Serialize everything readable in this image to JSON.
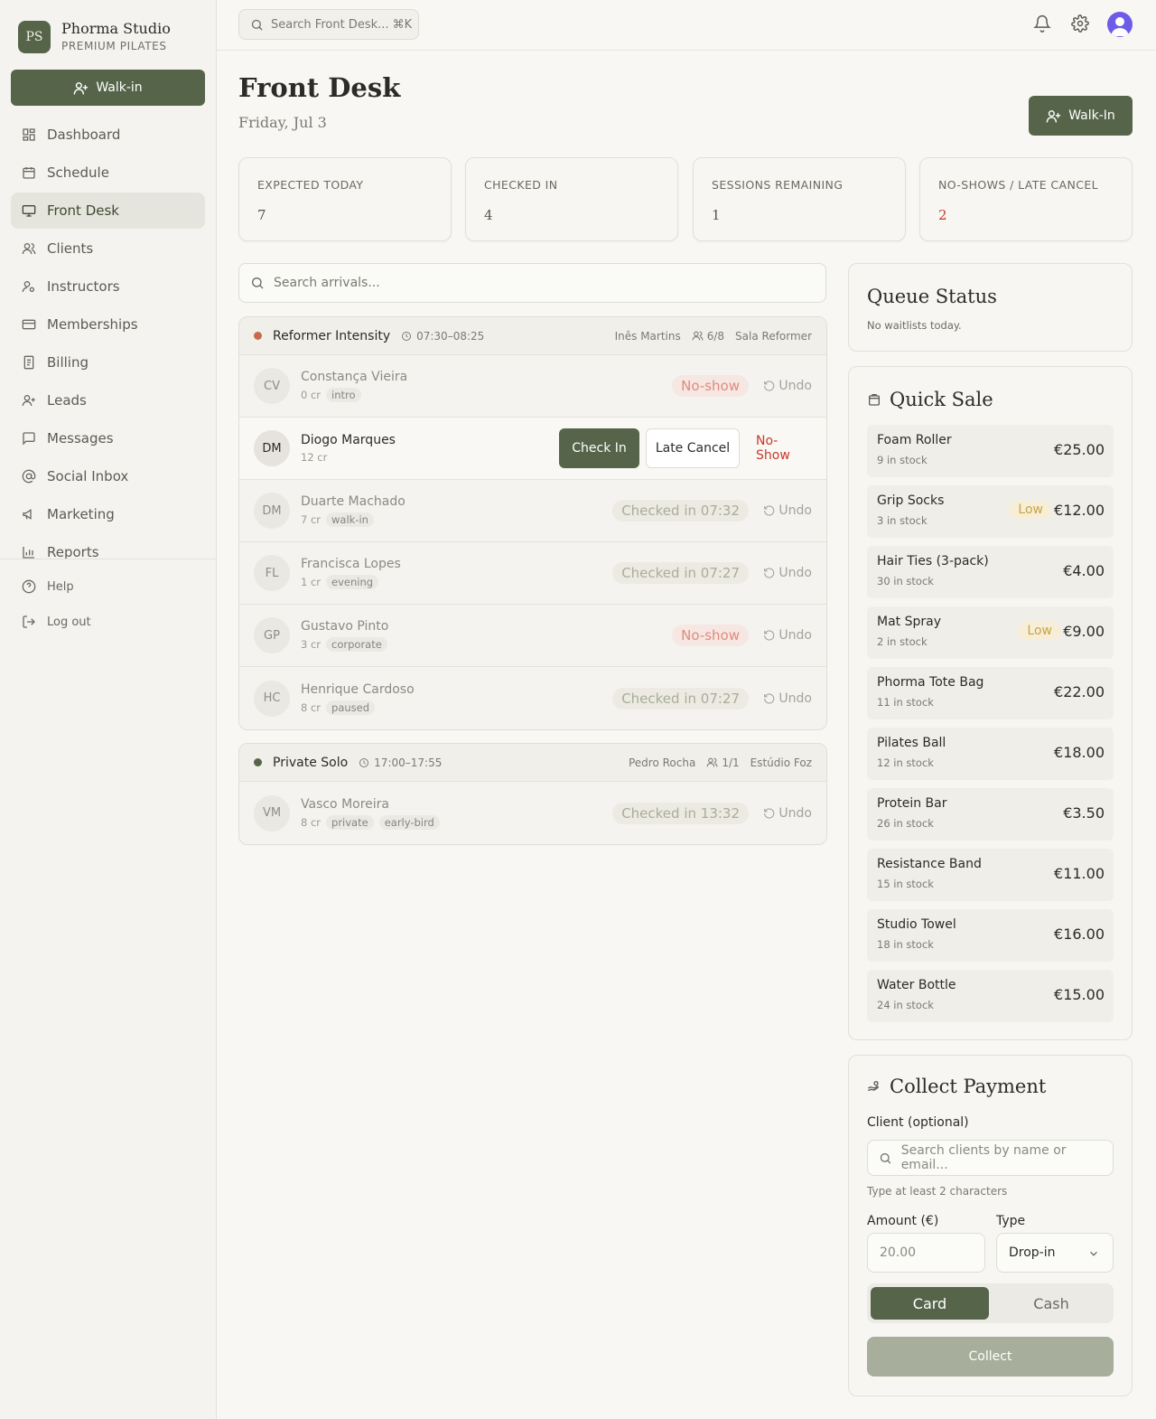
{
  "brand": {
    "initials": "PS",
    "name": "Phorma Studio",
    "tagline": "PREMIUM PILATES"
  },
  "sidebar": {
    "walkin_label": "Walk-in",
    "items": [
      {
        "label": "Dashboard",
        "icon": "dashboard-icon"
      },
      {
        "label": "Schedule",
        "icon": "calendar-icon"
      },
      {
        "label": "Front Desk",
        "icon": "monitor-icon",
        "active": true
      },
      {
        "label": "Clients",
        "icon": "users-icon"
      },
      {
        "label": "Instructors",
        "icon": "instructor-icon"
      },
      {
        "label": "Memberships",
        "icon": "card-icon"
      },
      {
        "label": "Billing",
        "icon": "receipt-icon"
      },
      {
        "label": "Leads",
        "icon": "user-plus-icon"
      },
      {
        "label": "Messages",
        "icon": "message-icon"
      },
      {
        "label": "Social Inbox",
        "icon": "at-icon"
      },
      {
        "label": "Marketing",
        "icon": "megaphone-icon"
      },
      {
        "label": "Reports",
        "icon": "bar-chart-icon"
      }
    ],
    "footer": [
      {
        "label": "Help",
        "icon": "help-icon"
      },
      {
        "label": "Log out",
        "icon": "logout-icon"
      }
    ]
  },
  "topbar": {
    "search_placeholder": "Search Front Desk... ⌘K"
  },
  "header": {
    "title": "Front Desk",
    "date": "Friday, Jul 3",
    "walkin_label": "Walk-In"
  },
  "stats": [
    {
      "label": "EXPECTED TODAY",
      "value": "7"
    },
    {
      "label": "CHECKED IN",
      "value": "4"
    },
    {
      "label": "SESSIONS REMAINING",
      "value": "1"
    },
    {
      "label": "NO-SHOWS / LATE CANCEL",
      "value": "2"
    }
  ],
  "arrivals": {
    "search_placeholder": "Search arrivals...",
    "sessions": [
      {
        "title": "Reformer Intensity",
        "time": "07:30–08:25",
        "instructor": "Inês Martins",
        "capacity": "6/8",
        "room": "Sala Reformer",
        "clients": [
          {
            "initials": "CV",
            "name": "Constança Vieira",
            "credits": "0 cr",
            "tags": [
              "intro"
            ],
            "status": "No-show",
            "undo": "Undo"
          },
          {
            "initials": "DM",
            "name": "Diogo Marques",
            "credits": "12 cr",
            "tags": [],
            "check_in": "Check In",
            "late_cancel": "Late Cancel",
            "no_show": "No-Show"
          },
          {
            "initials": "DM",
            "name": "Duarte Machado",
            "credits": "7 cr",
            "tags": [
              "walk-in"
            ],
            "status": "Checked in 07:32",
            "undo": "Undo"
          },
          {
            "initials": "FL",
            "name": "Francisca Lopes",
            "credits": "1 cr",
            "tags": [
              "evening"
            ],
            "status": "Checked in 07:27",
            "undo": "Undo"
          },
          {
            "initials": "GP",
            "name": "Gustavo Pinto",
            "credits": "3 cr",
            "tags": [
              "corporate"
            ],
            "status": "No-show",
            "undo": "Undo"
          },
          {
            "initials": "HC",
            "name": "Henrique Cardoso",
            "credits": "8 cr",
            "tags": [
              "paused"
            ],
            "status": "Checked in 07:27",
            "undo": "Undo"
          }
        ]
      },
      {
        "title": "Private Solo",
        "time": "17:00–17:55",
        "instructor": "Pedro Rocha",
        "capacity": "1/1",
        "room": "Estúdio Foz",
        "clients": [
          {
            "initials": "VM",
            "name": "Vasco Moreira",
            "credits": "8 cr",
            "tags": [
              "private",
              "early-bird"
            ],
            "status": "Checked in 13:32",
            "undo": "Undo"
          }
        ]
      }
    ]
  },
  "queue": {
    "title": "Queue Status",
    "message": "No waitlists today."
  },
  "quick_sale": {
    "title": "Quick Sale",
    "low_label": "Low",
    "items": [
      {
        "name": "Foam Roller",
        "stock": "9 in stock",
        "price": "€25.00"
      },
      {
        "name": "Grip Socks",
        "stock": "3 in stock",
        "price": "€12.00",
        "low": true
      },
      {
        "name": "Hair Ties (3-pack)",
        "stock": "30 in stock",
        "price": "€4.00"
      },
      {
        "name": "Mat Spray",
        "stock": "2 in stock",
        "price": "€9.00",
        "low": true
      },
      {
        "name": "Phorma Tote Bag",
        "stock": "11 in stock",
        "price": "€22.00"
      },
      {
        "name": "Pilates Ball",
        "stock": "12 in stock",
        "price": "€18.00"
      },
      {
        "name": "Protein Bar",
        "stock": "26 in stock",
        "price": "€3.50"
      },
      {
        "name": "Resistance Band",
        "stock": "15 in stock",
        "price": "€11.00"
      },
      {
        "name": "Studio Towel",
        "stock": "18 in stock",
        "price": "€16.00"
      },
      {
        "name": "Water Bottle",
        "stock": "24 in stock",
        "price": "€15.00"
      }
    ]
  },
  "payment": {
    "title": "Collect Payment",
    "client_label": "Client (optional)",
    "client_placeholder": "Search clients by name or email...",
    "client_hint": "Type at least 2 characters",
    "amount_label": "Amount (€)",
    "amount_value": "20.00",
    "type_label": "Type",
    "type_value": "Drop-in",
    "method_card": "Card",
    "method_cash": "Cash",
    "collect_label": "Collect"
  },
  "colors": {
    "accent": "#56654a",
    "danger": "#c73a2c",
    "warning": "#caa443"
  }
}
